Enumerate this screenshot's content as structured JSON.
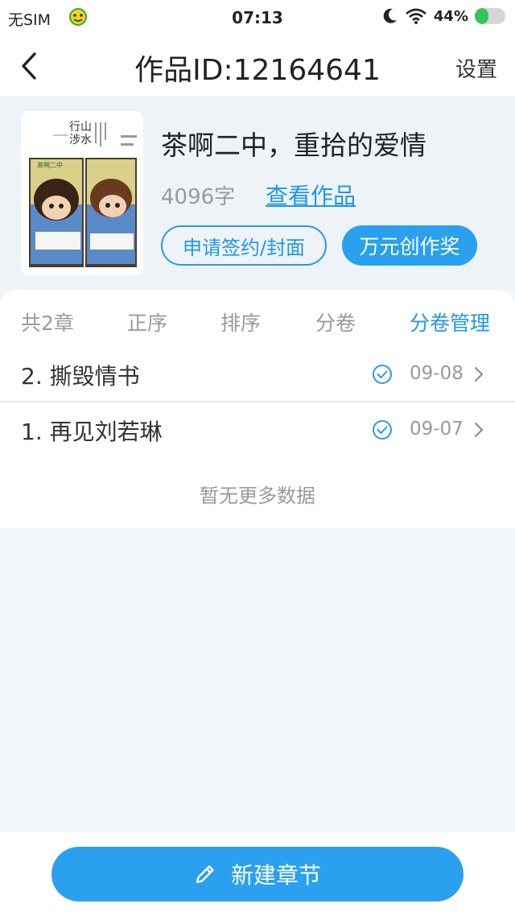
{
  "status_bar": {
    "carrier": "无SIM",
    "time": "07:13",
    "battery": "44%",
    "battery_level": 0.44
  },
  "header": {
    "title": "作品ID:12164641",
    "settings_label": "设置"
  },
  "work": {
    "title": "茶啊二中，重拾的爱情",
    "word_count": "4096字",
    "view_label": "查看作品",
    "apply_label": "申请签约/封面",
    "award_label": "万元创作奖",
    "cover_text": {
      "line1": "行山",
      "line2": "涉水",
      "panel_label": "茶啊二中"
    }
  },
  "toolbar": {
    "count": "共2章",
    "order": "正序",
    "sort": "排序",
    "volume": "分卷",
    "manage": "分卷管理"
  },
  "chapters": [
    {
      "title": "2. 撕毁情书",
      "date": "09-08"
    },
    {
      "title": "1. 再见刘若琳",
      "date": "09-07"
    }
  ],
  "no_more_label": "暂无更多数据",
  "new_chapter_label": "新建章节",
  "colors": {
    "accent": "#2aa0ee",
    "link": "#2196e8",
    "battery_green": "#35c45a"
  }
}
